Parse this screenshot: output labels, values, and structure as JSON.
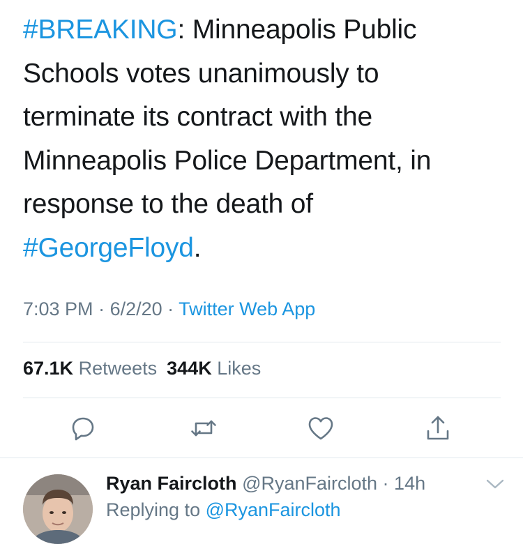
{
  "tweet": {
    "lines": [
      [
        {
          "text": "#BREAKING",
          "type": "hashtag"
        },
        {
          "text": ": Minneapolis Public",
          "type": "text"
        }
      ],
      [
        {
          "text": "Schools votes unanimously to",
          "type": "text"
        }
      ],
      [
        {
          "text": "terminate its contract with the",
          "type": "text"
        }
      ],
      [
        {
          "text": "Minneapolis Police Department, in",
          "type": "text"
        }
      ],
      [
        {
          "text": "response to the death of",
          "type": "text"
        }
      ],
      [
        {
          "text": "#GeorgeFloyd",
          "type": "hashtag"
        },
        {
          "text": ".",
          "type": "text"
        }
      ]
    ]
  },
  "meta": {
    "time": "7:03 PM",
    "sep1": " · ",
    "date": "6/2/20",
    "sep2": " · ",
    "source": "Twitter Web App"
  },
  "stats": {
    "retweets_count": "67.1K",
    "retweets_label": "Retweets",
    "likes_count": "344K",
    "likes_label": "Likes"
  },
  "actions": [
    {
      "name": "reply-button",
      "icon": "reply-icon"
    },
    {
      "name": "retweet-button",
      "icon": "retweet-icon"
    },
    {
      "name": "like-button",
      "icon": "heart-icon"
    },
    {
      "name": "share-button",
      "icon": "share-icon"
    }
  ],
  "reply": {
    "name": "Ryan Faircloth",
    "handle": "@RyanFaircloth",
    "sep": " · ",
    "time": "14h",
    "replying_prefix": "Replying to ",
    "replying_to": "@RyanFaircloth"
  },
  "colors": {
    "accent": "#1b95e0",
    "secondary_text": "#657786",
    "divider": "#e1e8ed"
  }
}
